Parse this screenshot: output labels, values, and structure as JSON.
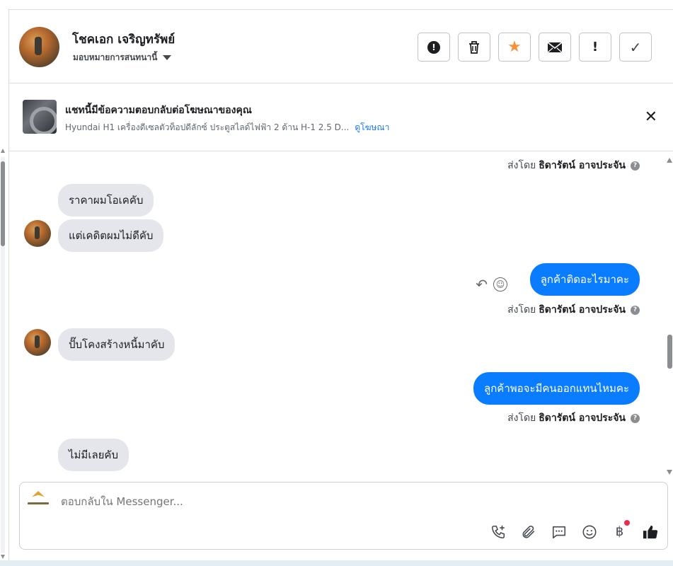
{
  "header": {
    "contact_name": "โชคเอก เจริญทรัพย์",
    "assign_label": "มอบหมายการสนทนานี้",
    "actions": [
      {
        "name": "spam-button",
        "icon": "alert-circle-icon",
        "glyph": "!"
      },
      {
        "name": "delete-button",
        "icon": "trash-icon",
        "glyph": "🗑"
      },
      {
        "name": "star-button",
        "icon": "star-icon",
        "glyph": "★"
      },
      {
        "name": "mark-unread-button",
        "icon": "envelope-icon",
        "glyph": "✉"
      },
      {
        "name": "follow-up-button",
        "icon": "exclamation-icon",
        "glyph": "!"
      },
      {
        "name": "mark-done-button",
        "icon": "check-icon",
        "glyph": "✓"
      }
    ]
  },
  "ad": {
    "title": "แชทนี้มีข้อความตอบกลับต่อโฆษณาของคุณ",
    "description": "Hyundai H1 เครื่องดีเซลตัวท็อปดีลักซ์ ประตูสไลด์ไฟฟ้า 2 ด้าน H-1 2.5 D...",
    "link_label": "ดูโฆษณา"
  },
  "messages": {
    "sent_by_prefix": "ส่งโดย",
    "agent_name": "ธิดารัตน์ อาจประจัน",
    "info_glyph": "?",
    "in_1": "ราคาผมโอเคคับ",
    "in_2": "แต่เคดิตผมไม่ดีคับ",
    "out_1": "ลูกค้าติดอะไรมาคะ",
    "in_3": "ปั๊บโคงสร้างหนี้มาคับ",
    "out_2": "ลูกค้าพอจะมีคนออกแทนไหมคะ",
    "in_4": "ไม่มีเลยคับ"
  },
  "composer": {
    "placeholder": "ตอบกลับใน Messenger...",
    "tools": [
      "call-icon",
      "attach-icon",
      "saved-reply-icon",
      "emoji-icon",
      "payment-icon",
      "like-icon"
    ],
    "baht_glyph": "฿"
  },
  "colors": {
    "outgoing_bubble": "#0a7cff",
    "incoming_bubble": "#e4e6eb",
    "star": "#f7923a",
    "link": "#1877f2",
    "notification_dot": "#f0284a"
  }
}
